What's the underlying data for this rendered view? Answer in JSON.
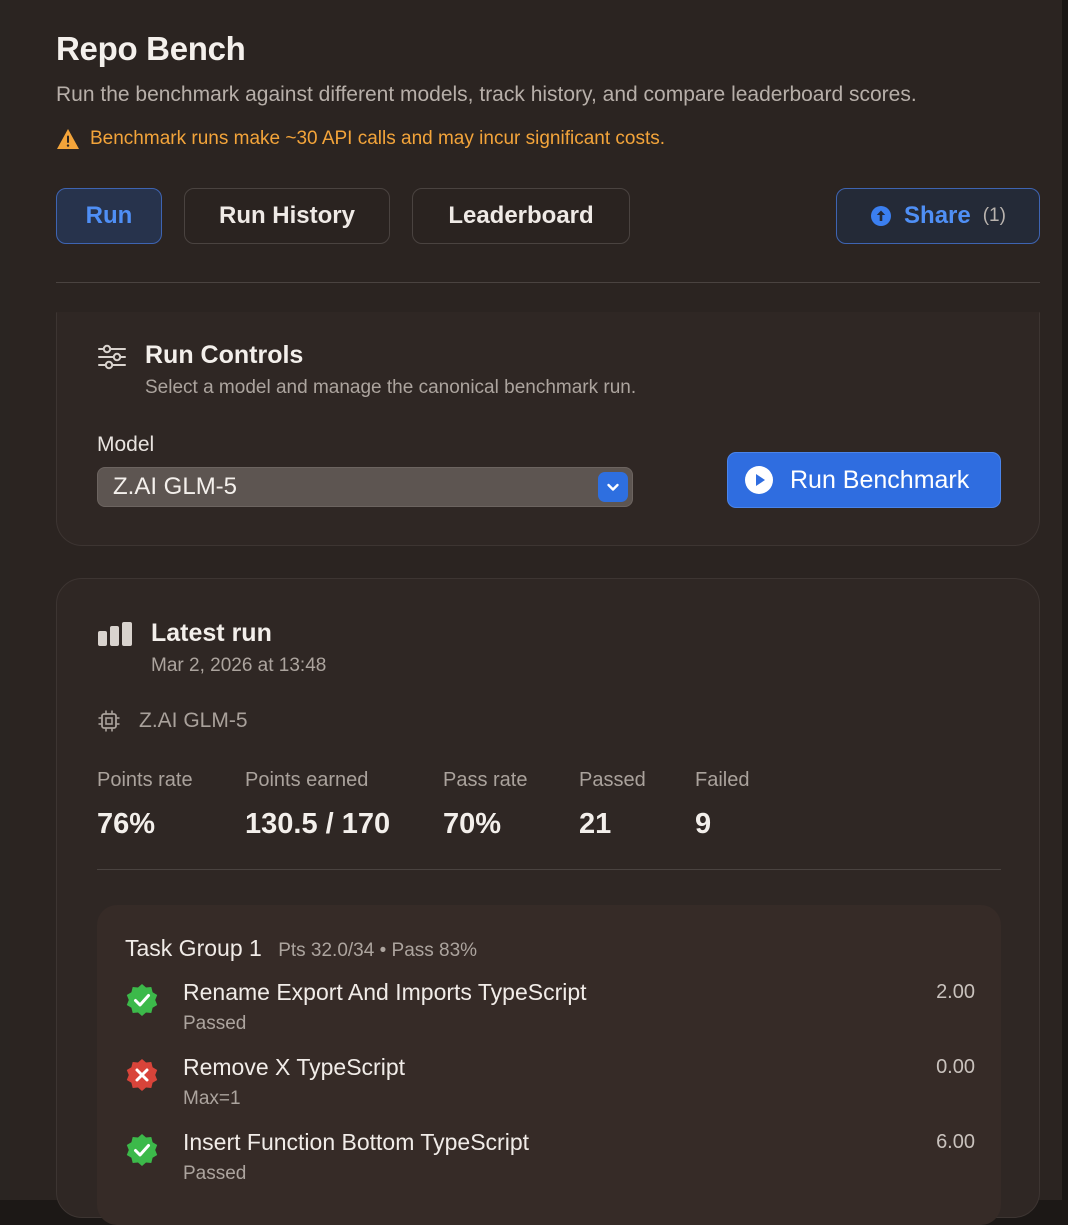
{
  "header": {
    "title": "Repo Bench",
    "subtitle": "Run the benchmark against different models, track history, and compare leaderboard scores.",
    "warning": "Benchmark runs make ~30 API calls and may incur significant costs."
  },
  "tabs": {
    "run": "Run",
    "history": "Run History",
    "leaderboard": "Leaderboard",
    "share": "Share",
    "share_count": "(1)"
  },
  "controls": {
    "title": "Run Controls",
    "subtitle": "Select a model and manage the canonical benchmark run.",
    "model_label": "Model",
    "model_value": "Z.AI GLM-5",
    "run_button": "Run Benchmark"
  },
  "latest": {
    "title": "Latest run",
    "timestamp": "Mar 2, 2026 at 13:48",
    "model": "Z.AI GLM-5",
    "stats": [
      {
        "label": "Points rate",
        "value": "76%"
      },
      {
        "label": "Points earned",
        "value": "130.5 / 170"
      },
      {
        "label": "Pass rate",
        "value": "70%"
      },
      {
        "label": "Passed",
        "value": "21"
      },
      {
        "label": "Failed",
        "value": "9"
      }
    ],
    "group": {
      "title": "Task Group 1",
      "meta": "Pts 32.0/34 • Pass 83%",
      "tasks": [
        {
          "name": "Rename Export And Imports TypeScript",
          "status": "Passed",
          "score": "2.00",
          "result": "pass"
        },
        {
          "name": "Remove X TypeScript",
          "status": "Max=1",
          "score": "0.00",
          "result": "fail"
        },
        {
          "name": "Insert Function Bottom TypeScript",
          "status": "Passed",
          "score": "6.00",
          "result": "pass"
        }
      ]
    }
  },
  "colors": {
    "accent": "#2f6de0",
    "warning": "#f3a43a",
    "pass": "#3cb94a",
    "fail": "#d9443a"
  },
  "icons": {
    "warning": "warning-triangle-icon",
    "share": "arrow-up-circle-icon",
    "controls": "sliders-icon",
    "select": "chevron-down-icon",
    "run": "play-circle-icon",
    "latest": "bar-chart-icon",
    "model": "cpu-chip-icon",
    "pass": "check-badge-icon",
    "fail": "x-badge-icon"
  }
}
